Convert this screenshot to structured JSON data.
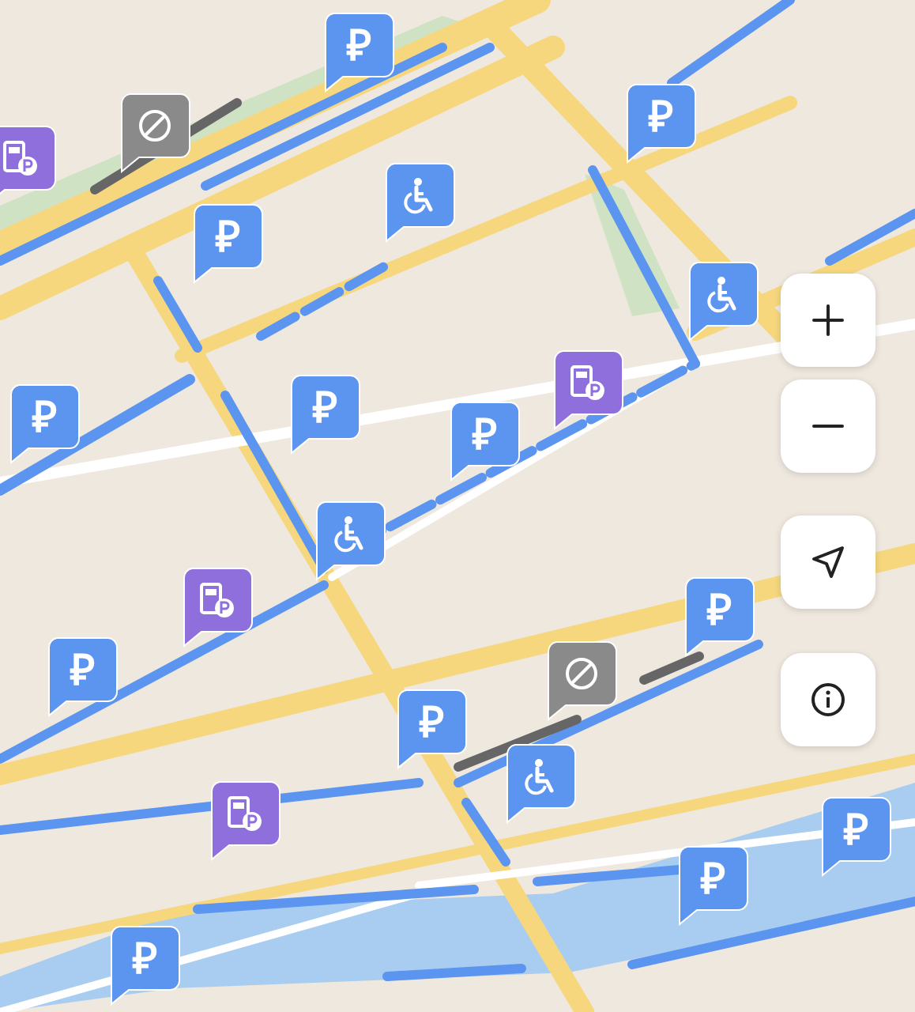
{
  "map": {
    "pins": [
      {
        "kind": "paid",
        "label": "₽"
      },
      {
        "kind": "paid",
        "label": "₽"
      },
      {
        "kind": "paid",
        "label": "₽"
      },
      {
        "kind": "paid",
        "label": "₽"
      },
      {
        "kind": "paid",
        "label": "₽"
      },
      {
        "kind": "paid",
        "label": "₽"
      },
      {
        "kind": "paid",
        "label": "₽"
      },
      {
        "kind": "paid",
        "label": "₽"
      },
      {
        "kind": "paid",
        "label": "₽"
      },
      {
        "kind": "paid",
        "label": "₽"
      },
      {
        "kind": "paid",
        "label": "₽"
      },
      {
        "kind": "paid",
        "label": "₽"
      },
      {
        "kind": "disabled"
      },
      {
        "kind": "disabled"
      },
      {
        "kind": "disabled"
      },
      {
        "kind": "disabled"
      },
      {
        "kind": "charging"
      },
      {
        "kind": "charging"
      },
      {
        "kind": "charging"
      },
      {
        "kind": "charging"
      },
      {
        "kind": "no_parking"
      },
      {
        "kind": "no_parking"
      }
    ]
  }
}
